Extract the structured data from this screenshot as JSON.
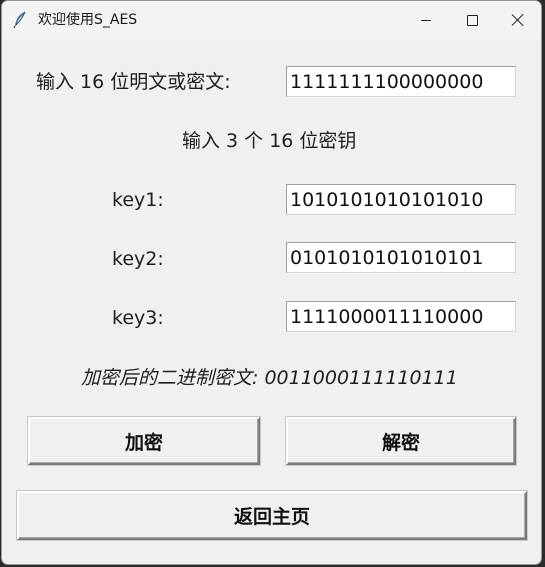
{
  "window": {
    "title": "欢迎使用S_AES"
  },
  "plaintext": {
    "label": "输入 16 位明文或密文:",
    "value": "1111111100000000"
  },
  "keys": {
    "heading": "输入 3 个 16 位密钥",
    "key1_label": "key1:",
    "key1_value": "1010101010101010",
    "key2_label": "key2:",
    "key2_value": "0101010101010101",
    "key3_label": "key3:",
    "key3_value": "1111000011110000"
  },
  "result": {
    "text": "加密后的二进制密文: 0011000111110111"
  },
  "buttons": {
    "encrypt": "加密",
    "decrypt": "解密",
    "home": "返回主页"
  },
  "colors": {
    "window_bg": "#f0f0f0",
    "titlebar_bg": "#f3f3f3",
    "field_bg": "#ffffff"
  },
  "icons": {
    "app": "feather-icon",
    "minimize": "minimize-icon",
    "maximize": "maximize-icon",
    "close": "close-icon"
  }
}
